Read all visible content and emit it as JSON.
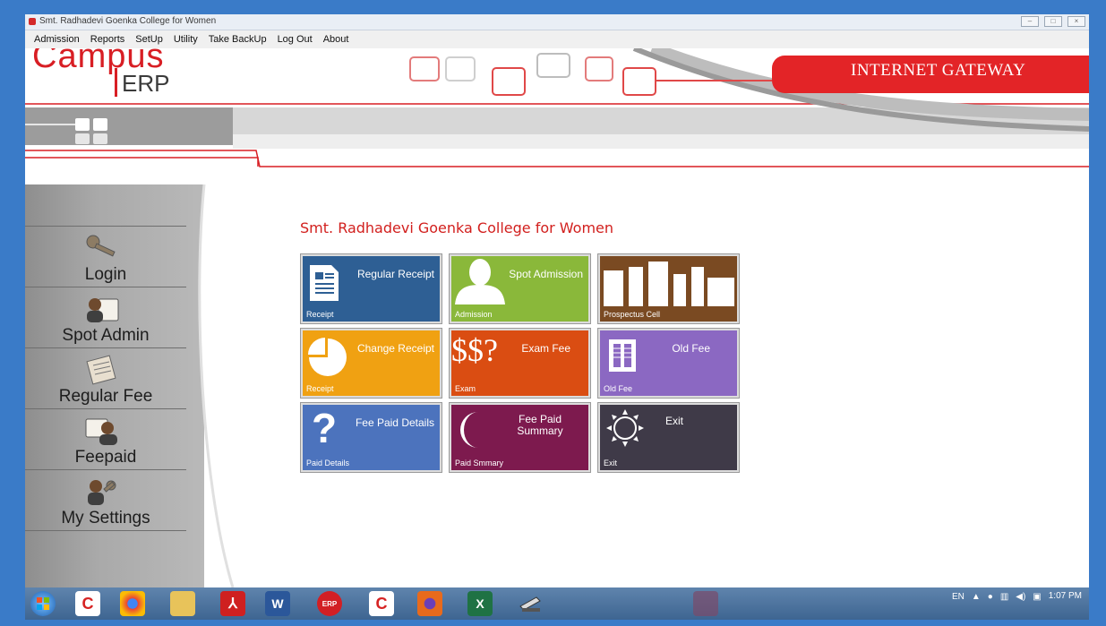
{
  "window": {
    "title": "Smt. Radhadevi Goenka College for Women"
  },
  "menu": [
    "Admission",
    "Reports",
    "SetUp",
    "Utility",
    "Take BackUp",
    "Log Out",
    "About"
  ],
  "header": {
    "logo_word": "Campus",
    "logo_sub": "ERP",
    "gateway": "INTERNET GATEWAY"
  },
  "sidebar": [
    {
      "label": "Login",
      "icon": "key-icon"
    },
    {
      "label": "Spot Admin",
      "icon": "user-card-icon"
    },
    {
      "label": "Regular Fee",
      "icon": "document-icon"
    },
    {
      "label": "Feepaid",
      "icon": "people-card-icon"
    },
    {
      "label": "My Settings",
      "icon": "user-key-icon"
    }
  ],
  "college_name": "Smt. Radhadevi Goenka College for Women",
  "tiles": [
    {
      "title": "Regular Receipt",
      "sub": "Receipt",
      "color": "#2e5f94",
      "icon": "receipt-icon"
    },
    {
      "title": "Spot Admission",
      "sub": "Admission",
      "color": "#8ab83a",
      "icon": "person-icon"
    },
    {
      "title": "",
      "sub": "Prospectus Cell",
      "color": "#7a4a22",
      "icon": "buildings-icon"
    },
    {
      "title": "Change Receipt",
      "sub": "Receipt",
      "color": "#f0a112",
      "icon": "pie-icon"
    },
    {
      "title": "Exam Fee",
      "sub": "Exam",
      "color": "#da4d12",
      "icon": "dollar-icon",
      "icon_text": "$$?"
    },
    {
      "title": "Old Fee",
      "sub": "Old Fee",
      "color": "#8b68c2",
      "icon": "book-icon"
    },
    {
      "title": "Fee Paid Details",
      "sub": "Paid Details",
      "color": "#4c73bd",
      "icon": "question-icon",
      "icon_text": "?"
    },
    {
      "title": "Fee Paid Summary",
      "sub": "Paid Smmary",
      "color": "#7d1a4e",
      "icon": "moon-icon"
    },
    {
      "title": "Exit",
      "sub": "Exit",
      "color": "#3f3a48",
      "icon": "sun-icon"
    }
  ],
  "taskbar": {
    "apps": [
      {
        "name": "start-button",
        "glyph": "",
        "color": "#2d7fd1"
      },
      {
        "name": "app-c-red",
        "glyph": "C",
        "color": "#d62222"
      },
      {
        "name": "chrome-icon",
        "glyph": "",
        "color": "#e8a91a"
      },
      {
        "name": "folder-icon",
        "glyph": "",
        "color": "#e8c35a"
      },
      {
        "name": "pdf-icon",
        "glyph": "",
        "color": "#cf2020"
      },
      {
        "name": "word-icon",
        "glyph": "W",
        "color": "#2b579a"
      },
      {
        "name": "erp-icon",
        "glyph": "ERP",
        "color": "#d21f24"
      },
      {
        "name": "app-c-red-2",
        "glyph": "C",
        "color": "#d62222"
      },
      {
        "name": "firefox-icon",
        "glyph": "",
        "color": "#e86a1c"
      },
      {
        "name": "excel-icon",
        "glyph": "X",
        "color": "#1f7244"
      },
      {
        "name": "scanner-icon",
        "glyph": "",
        "color": "#8a8a8a"
      }
    ],
    "lang": "EN",
    "time": "1:07 PM"
  }
}
